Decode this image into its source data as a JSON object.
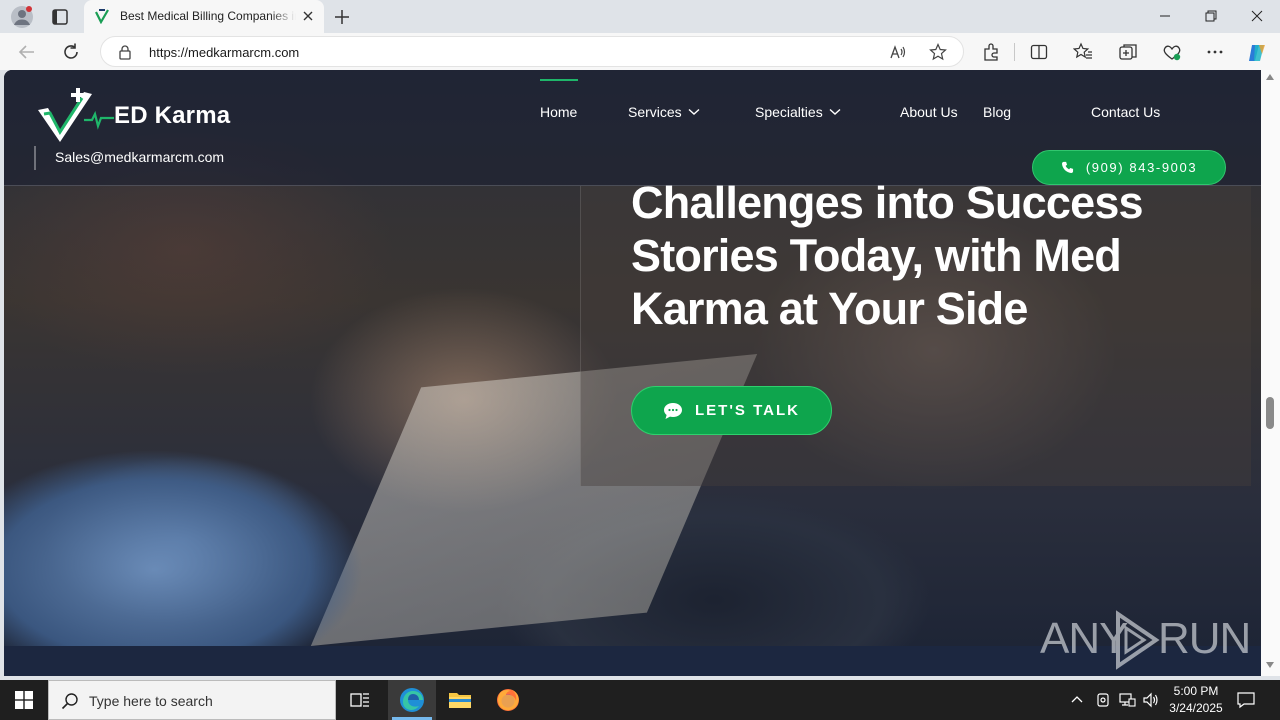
{
  "browser": {
    "tab_title": "Best Medical Billing Companies in",
    "url": "https://medkarmarcm.com"
  },
  "site": {
    "logo_text": "ED Karma",
    "email": "Sales@medkarmarcm.com",
    "nav": {
      "home": "Home",
      "services": "Services",
      "specialties": "Specialties",
      "about": "About Us",
      "blog": "Blog",
      "contact": "Contact Us"
    },
    "phone": "(909) 843-9003",
    "headline": "Challenges into Success Stories Today, with Med Karma at Your Side",
    "cta": "LET'S TALK",
    "accent_color": "#0ea54d"
  },
  "watermark": {
    "left": "ANY",
    "right": "RUN"
  },
  "taskbar": {
    "search_placeholder": "Type here to search",
    "time": "5:00 PM",
    "date": "3/24/2025"
  }
}
